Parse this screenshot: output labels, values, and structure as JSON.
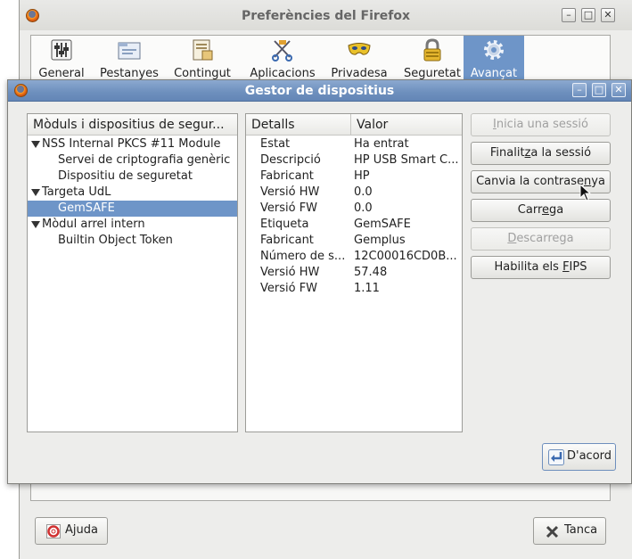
{
  "prefs_window": {
    "title": "Preferències del Firefox",
    "tabs": [
      {
        "label": "General",
        "icon": "sliders-icon"
      },
      {
        "label": "Pestanyes",
        "icon": "tabs-icon"
      },
      {
        "label": "Contingut",
        "icon": "content-icon"
      },
      {
        "label": "Aplicacions",
        "icon": "applications-icon"
      },
      {
        "label": "Privadesa",
        "icon": "mask-icon"
      },
      {
        "label": "Seguretat",
        "icon": "padlock-icon"
      },
      {
        "label": "Avançat",
        "icon": "gear-icon",
        "active": true
      }
    ],
    "help_button": "Ajuda",
    "close_button": "Tanca"
  },
  "device_manager": {
    "title": "Gestor de dispositius",
    "modules_header": "Mòduls i dispositius de segur...",
    "tree": [
      {
        "label": "NSS Internal PKCS #11 Module",
        "level": 0,
        "expanded": true
      },
      {
        "label": "Servei de criptografia genèric",
        "level": 1
      },
      {
        "label": "Dispositiu de seguretat",
        "level": 1
      },
      {
        "label": "Targeta UdL",
        "level": 0,
        "expanded": true
      },
      {
        "label": "GemSAFE",
        "level": 1,
        "selected": true
      },
      {
        "label": "Mòdul arrel intern",
        "level": 0,
        "expanded": true
      },
      {
        "label": "Builtin Object Token",
        "level": 1
      }
    ],
    "details_header": "Detalls",
    "value_header": "Valor",
    "details": [
      {
        "key": "Estat",
        "value": "Ha entrat"
      },
      {
        "key": "Descripció",
        "value": "HP USB Smart C..."
      },
      {
        "key": "Fabricant",
        "value": "HP"
      },
      {
        "key": "Versió HW",
        "value": "0.0"
      },
      {
        "key": "Versió FW",
        "value": "0.0"
      },
      {
        "key": "Etiqueta",
        "value": "GemSAFE"
      },
      {
        "key": "Fabricant",
        "value": "Gemplus"
      },
      {
        "key": "Número de s...",
        "value": "12C00016CD0B..."
      },
      {
        "key": "Versió HW",
        "value": "57.48"
      },
      {
        "key": "Versió FW",
        "value": "1.11"
      }
    ],
    "buttons": {
      "login": {
        "pre": "",
        "u": "I",
        "post": "nicia una sessió",
        "disabled": true
      },
      "logout": {
        "pre": "Finalit",
        "u": "z",
        "post": "a la sessió",
        "disabled": false
      },
      "change_password": {
        "pre": "Canvia la contrase",
        "u": "n",
        "post": "ya",
        "disabled": false
      },
      "load": {
        "pre": "Carr",
        "u": "e",
        "post": "ga",
        "disabled": false
      },
      "unload": {
        "pre": "",
        "u": "D",
        "post": "escarrega",
        "disabled": true
      },
      "enable_fips": {
        "pre": "Habilita els ",
        "u": "F",
        "post": "IPS",
        "disabled": false
      }
    },
    "ok_button": "D'acord"
  },
  "colors": {
    "selection": "#6e95c8",
    "dialog_title_bar": "#6d8fbd",
    "window_bg": "#ededeb"
  }
}
